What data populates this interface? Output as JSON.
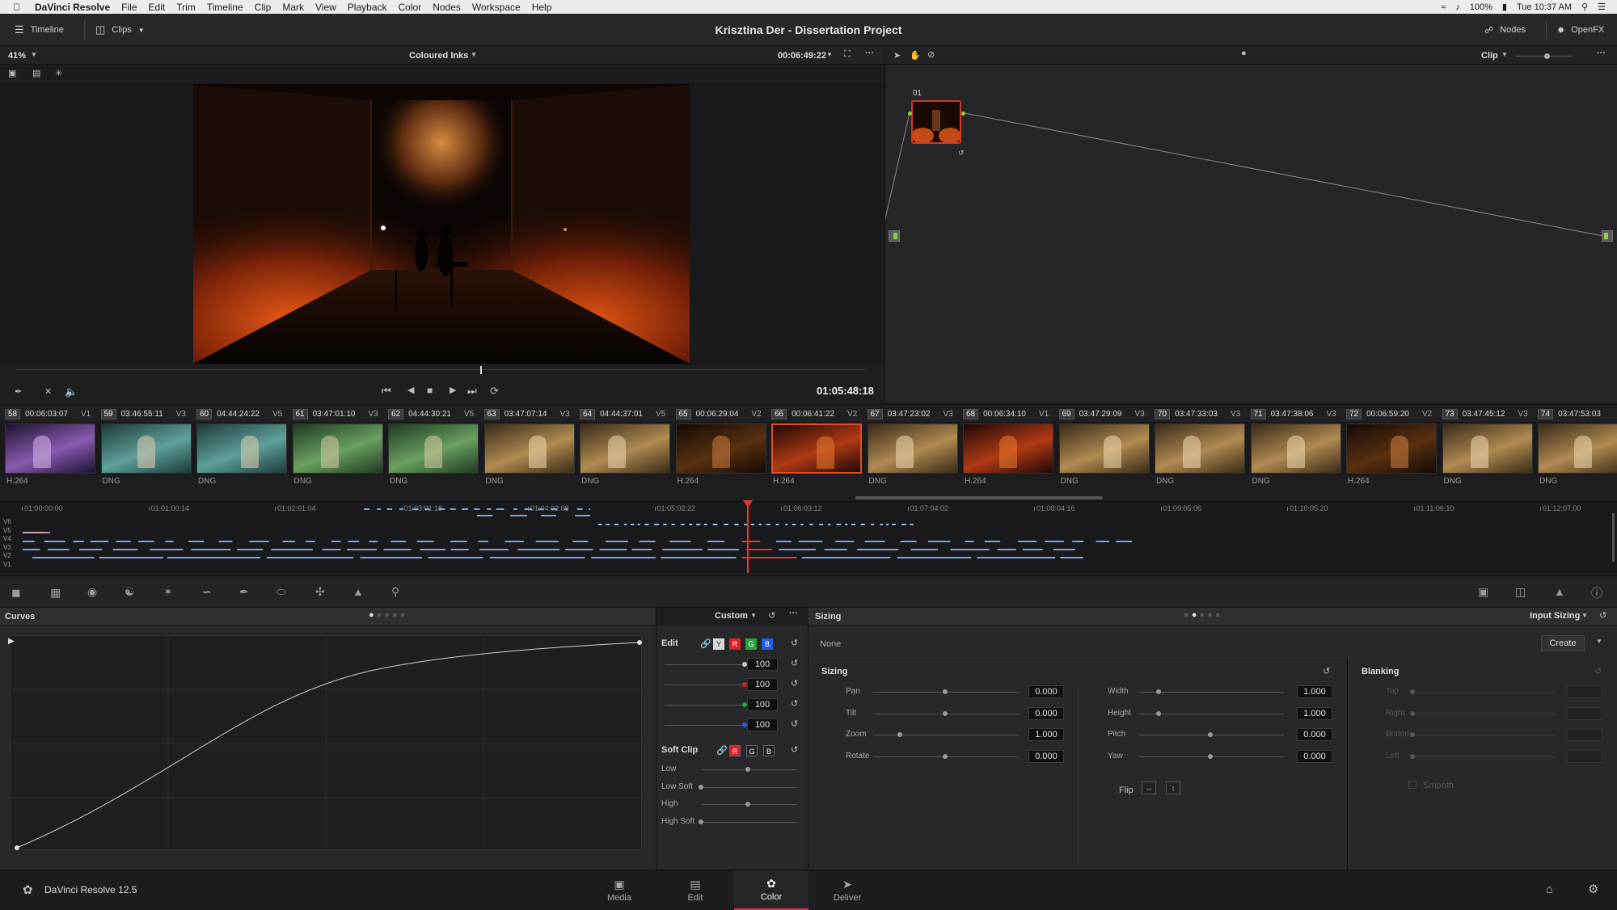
{
  "mac_menubar": {
    "app_name": "DaVinci Resolve",
    "menus": [
      "File",
      "Edit",
      "Trim",
      "Timeline",
      "Clip",
      "Mark",
      "View",
      "Playback",
      "Color",
      "Nodes",
      "Workspace",
      "Help"
    ],
    "battery": "100%",
    "clock": "Tue 10:37 AM"
  },
  "topbar": {
    "timeline_label": "Timeline",
    "clips_label": "Clips",
    "project_title": "Krisztina Der - Dissertation Project",
    "nodes_label": "Nodes",
    "openfx_label": "OpenFX"
  },
  "viewer": {
    "zoom": "41%",
    "timeline_name": "Coloured Inks",
    "timecode": "00:06:49:22",
    "playhead_timecode": "01:05:48:18"
  },
  "node_editor": {
    "mode_label": "Clip",
    "node_number": "01"
  },
  "clips": [
    {
      "num": "58",
      "tc": "00:06:03:07",
      "track": "V1",
      "fmt": "H.264",
      "tone": "purple"
    },
    {
      "num": "59",
      "tc": "03:46:55:11",
      "track": "V3",
      "fmt": "DNG",
      "tone": "teal"
    },
    {
      "num": "60",
      "tc": "04:44:24:22",
      "track": "V5",
      "fmt": "DNG",
      "tone": "teal"
    },
    {
      "num": "61",
      "tc": "03:47:01:10",
      "track": "V3",
      "fmt": "DNG",
      "tone": "green"
    },
    {
      "num": "62",
      "tc": "04:44:30:21",
      "track": "V5",
      "fmt": "DNG",
      "tone": "green"
    },
    {
      "num": "63",
      "tc": "03:47:07:14",
      "track": "V3",
      "fmt": "DNG",
      "tone": "warm"
    },
    {
      "num": "64",
      "tc": "04:44:37:01",
      "track": "V5",
      "fmt": "DNG",
      "tone": "warm"
    },
    {
      "num": "65",
      "tc": "00:06:29:04",
      "track": "V2",
      "fmt": "H.264",
      "tone": "dark"
    },
    {
      "num": "66",
      "tc": "00:06:41:22",
      "track": "V2",
      "fmt": "H.264",
      "tone": "red"
    },
    {
      "num": "67",
      "tc": "03:47:23:02",
      "track": "V3",
      "fmt": "DNG",
      "tone": "warm"
    },
    {
      "num": "68",
      "tc": "00:06:34:10",
      "track": "V1",
      "fmt": "H.264",
      "tone": "red"
    },
    {
      "num": "69",
      "tc": "03:47:29:09",
      "track": "V3",
      "fmt": "DNG",
      "tone": "warm"
    },
    {
      "num": "70",
      "tc": "03:47:33:03",
      "track": "V3",
      "fmt": "DNG",
      "tone": "warm"
    },
    {
      "num": "71",
      "tc": "03:47:38:06",
      "track": "V3",
      "fmt": "DNG",
      "tone": "warm"
    },
    {
      "num": "72",
      "tc": "00:06:59:20",
      "track": "V2",
      "fmt": "H.264",
      "tone": "dark"
    },
    {
      "num": "73",
      "tc": "03:47:45:12",
      "track": "V3",
      "fmt": "DNG",
      "tone": "warm"
    },
    {
      "num": "74",
      "tc": "03:47:53:03",
      "track": "",
      "fmt": "DNG",
      "tone": "warm"
    }
  ],
  "selected_clip_index": 8,
  "mini_timeline": {
    "ruler": [
      "01:00:00:00",
      "01:01:00:14",
      "01:02:01:04",
      "01:03:01:18",
      "01:04:02:08",
      "01:05:02:22",
      "01:06:03:12",
      "01:07:04:02",
      "01:08:04:16",
      "01:09:05:06",
      "01:10:05:20",
      "01:11:06:10",
      "01:12:07:00"
    ],
    "tracks": [
      "V6",
      "V5",
      "V4",
      "V3",
      "V2",
      "V1"
    ]
  },
  "curves": {
    "title": "Curves",
    "preset": "Custom",
    "edit_label": "Edit",
    "channels": [
      "Y",
      "R",
      "G",
      "B"
    ],
    "intensity_values": [
      "100",
      "100",
      "100",
      "100"
    ],
    "soft_clip_label": "Soft Clip",
    "soft_clip_channels": [
      "R",
      "G",
      "B"
    ],
    "soft_clip_rows": [
      "Low",
      "Low Soft",
      "High",
      "High Soft"
    ]
  },
  "sizing": {
    "title": "Sizing",
    "mode": "Input Sizing",
    "preset": "None",
    "create_label": "Create",
    "section_label": "Sizing",
    "left_params": [
      {
        "label": "Pan",
        "value": "0.000"
      },
      {
        "label": "Tilt",
        "value": "0.000"
      },
      {
        "label": "Zoom",
        "value": "1.000"
      },
      {
        "label": "Rotate",
        "value": "0.000"
      }
    ],
    "right_params": [
      {
        "label": "Width",
        "value": "1.000"
      },
      {
        "label": "Height",
        "value": "1.000"
      },
      {
        "label": "Pitch",
        "value": "0.000"
      },
      {
        "label": "Yaw",
        "value": "0.000"
      }
    ],
    "flip_label": "Flip",
    "blanking_label": "Blanking",
    "blanking_params": [
      "Top",
      "Right",
      "Bottom",
      "Left"
    ],
    "smooth_label": "Smooth"
  },
  "bottombar": {
    "app_version": "DaVinci Resolve 12.5",
    "pages": [
      "Media",
      "Edit",
      "Color",
      "Deliver"
    ],
    "active_page": "Color"
  }
}
